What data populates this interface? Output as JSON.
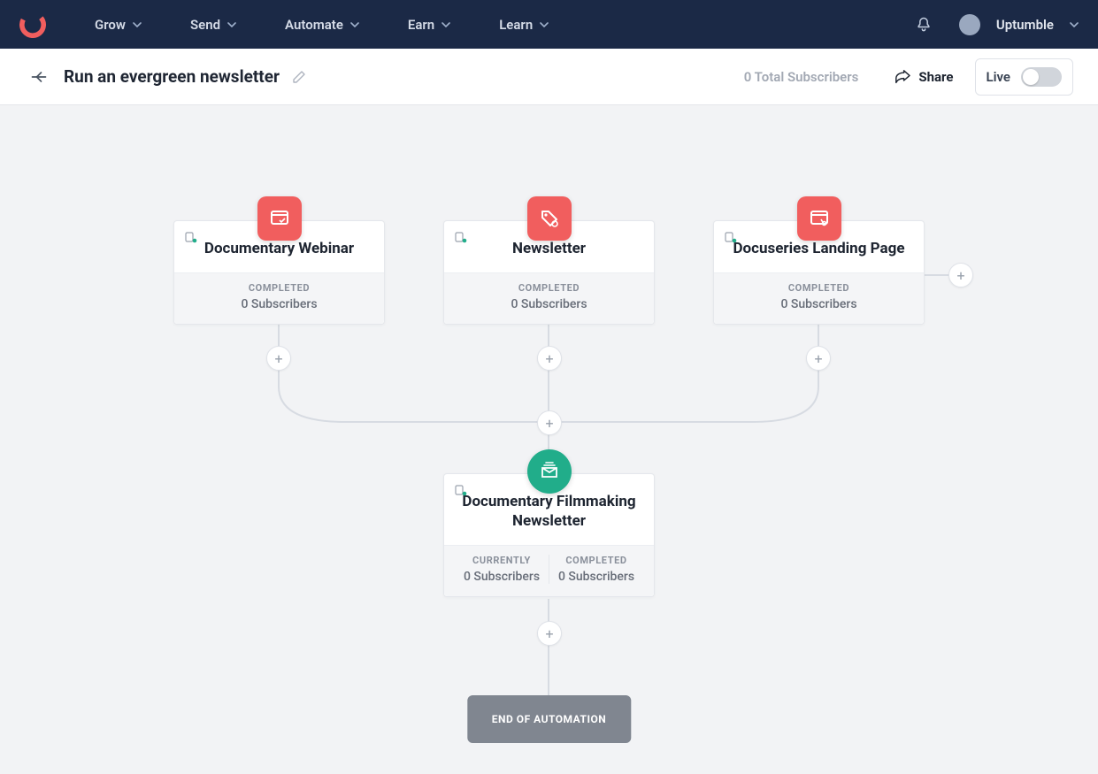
{
  "nav": {
    "items": [
      "Grow",
      "Send",
      "Automate",
      "Earn",
      "Learn"
    ],
    "user": "Uptumble"
  },
  "subheader": {
    "title": "Run an evergreen newsletter",
    "subscribers": "0 Total Subscribers",
    "share": "Share",
    "live": "Live"
  },
  "nodes": {
    "n1": {
      "title": "Documentary Webinar",
      "completedLabel": "COMPLETED",
      "completedValue": "0 Subscribers"
    },
    "n2": {
      "title": "Newsletter",
      "completedLabel": "COMPLETED",
      "completedValue": "0 Subscribers"
    },
    "n3": {
      "title": "Docuseries Landing Page",
      "completedLabel": "COMPLETED",
      "completedValue": "0 Subscribers"
    },
    "n4": {
      "title": "Documentary Filmmaking Newsletter",
      "currentlyLabel": "CURRENTLY",
      "currentlyValue": "0 Subscribers",
      "completedLabel": "COMPLETED",
      "completedValue": "0 Subscribers"
    }
  },
  "end": "END OF AUTOMATION"
}
